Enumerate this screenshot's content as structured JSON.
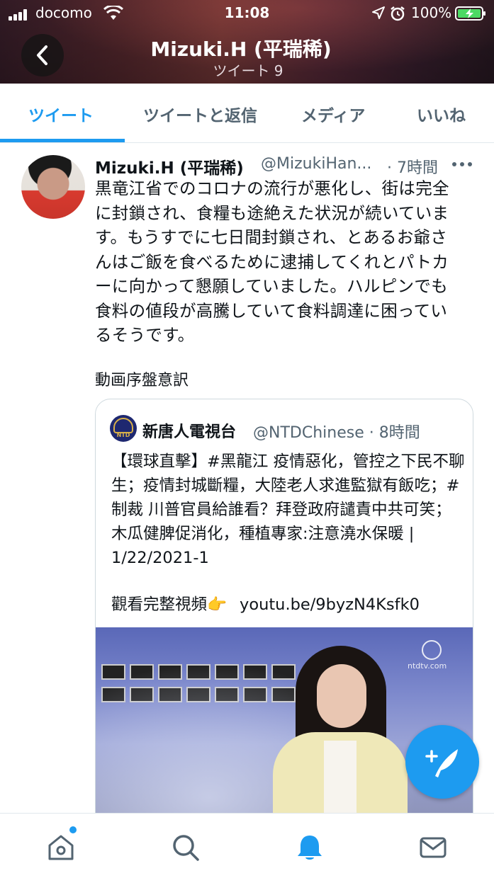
{
  "status_bar": {
    "carrier": "docomo",
    "time": "11:08",
    "battery": "100%"
  },
  "header": {
    "title": "Mizuki.H (平瑞稀)",
    "subtitle": "ツイート 9"
  },
  "tabs": [
    {
      "label": "ツイート",
      "active": true
    },
    {
      "label": "ツイートと返信",
      "active": false
    },
    {
      "label": "メディア",
      "active": false
    },
    {
      "label": "いいね",
      "active": false
    }
  ],
  "tweet": {
    "name": "Mizuki.H (平瑞稀)",
    "handle": "@MizukiHan...",
    "time": "· 7時間",
    "body": "黒竜江省でのコロナの流行が悪化し、街は完全に封鎖され、食糧も途絶えた状況が続いています。もうすでに七日間封鎖され、とあるお爺さんはご飯を食べるために逮捕してくれとパトカーに向かって懇願していました。ハルピンでも食料の値段が高騰していて食料調達に困っているそうです。",
    "subtext": "動画序盤意訳"
  },
  "quoted_tweet": {
    "name": "新唐人電視台",
    "handle": "@NTDChinese · 8時間",
    "body": "【環球直擊】#黑龍江 疫情惡化，管控之下民不聊生；疫情封城斷糧，大陸老人求進監獄有飯吃；#制裁 川普官員給誰看？拜登政府譴責中共可笑；木瓜健脾促消化，種植專家:注意澆水保暖 | 1/22/2021-1",
    "link_prefix": "觀看完整視頻👉",
    "link": "youtu.be/9byzN4Ksfk0",
    "avatar_text": "NTD",
    "watermark": "ntdtv.com"
  },
  "colors": {
    "accent": "#1d9bf0",
    "text_primary": "#0f1419",
    "text_secondary": "#536471"
  },
  "icons": {
    "back": "chevron-left-icon",
    "more": "more-horizontal-icon",
    "compose": "compose-tweet-icon",
    "nav": [
      "home-icon",
      "search-icon",
      "notifications-bell-icon",
      "messages-envelope-icon"
    ]
  }
}
